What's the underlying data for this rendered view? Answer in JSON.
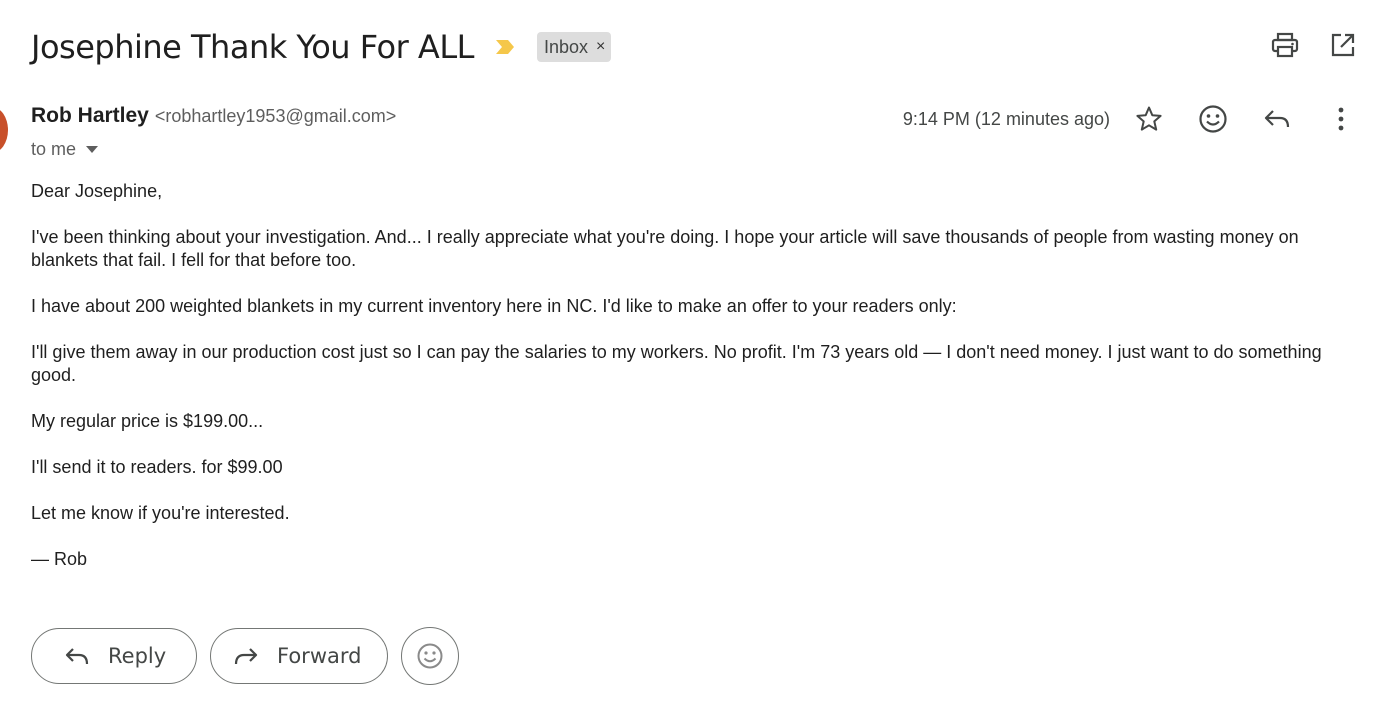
{
  "header": {
    "subject": "Josephine Thank You For ALL",
    "label": "Inbox",
    "label_close": "×",
    "colors": {
      "importance": "#f5c74a",
      "chip_bg": "#dddddd"
    },
    "icons": [
      "print-icon",
      "open-in-new-window-icon"
    ]
  },
  "message": {
    "sender_name": "Rob Hartley",
    "sender_email": "<robhartley1953@gmail.com>",
    "to": "to me",
    "timestamp": "9:14 PM (12 minutes ago)",
    "avatar_color": "#c8502a",
    "actions_icons": [
      "star-icon",
      "emoji-react-icon",
      "reply-icon",
      "more-vert-icon"
    ],
    "body": [
      "Dear Josephine,",
      "I've been thinking about your investigation. And... I really appreciate what you're doing. I hope your article will save thousands of people from wasting money on blankets that fail. I fell for that before too.",
      "I have about 200 weighted blankets in my current inventory here in NC. I'd like to make an offer to your readers only:",
      "I'll give them away in our production cost just so I can pay the salaries to my workers. No profit. I'm 73 years old — I don't need money. I just want to do something good.",
      "My regular price is $199.00...",
      "I'll send it to readers. for $99.00",
      "Let me know if you're interested.",
      "— Rob"
    ]
  },
  "footer": {
    "reply_label": "Reply",
    "forward_label": "Forward"
  }
}
